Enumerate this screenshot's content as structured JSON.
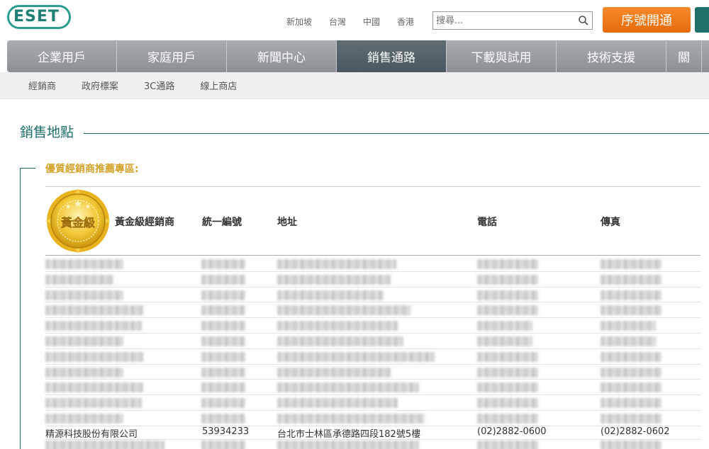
{
  "header": {
    "logo": "ESET",
    "lang_links": [
      "新加坡",
      "台灣",
      "中國",
      "香港"
    ],
    "search_placeholder": "搜尋...",
    "orange_button": "序號開通"
  },
  "nav": {
    "items": [
      "企業用戶",
      "家庭用戶",
      "新聞中心",
      "銷售通路",
      "下載與試用",
      "技術支援",
      "關"
    ],
    "active_index": 3
  },
  "subnav": {
    "items": [
      "經銷商",
      "政府標案",
      "3C通路",
      "線上商店"
    ]
  },
  "page": {
    "section_title": "銷售地點",
    "sub_title": "優質經銷商推薦專區:"
  },
  "badge": {
    "main_text": "黃金級"
  },
  "table": {
    "headers": [
      "黃金級經銷商",
      "統一編號",
      "地址",
      "電話",
      "傳真"
    ],
    "visible_row": {
      "name": "精源科技股份有限公司",
      "tax_id": "53934233",
      "address": "台北市士林區承德路四段182號5樓",
      "phone": "(02)2882-0600",
      "fax": "(02)2882-0602"
    }
  },
  "colors": {
    "brand_teal": "#1f6f6a",
    "orange": "#e86a0a",
    "gold": "#d4a32c"
  }
}
